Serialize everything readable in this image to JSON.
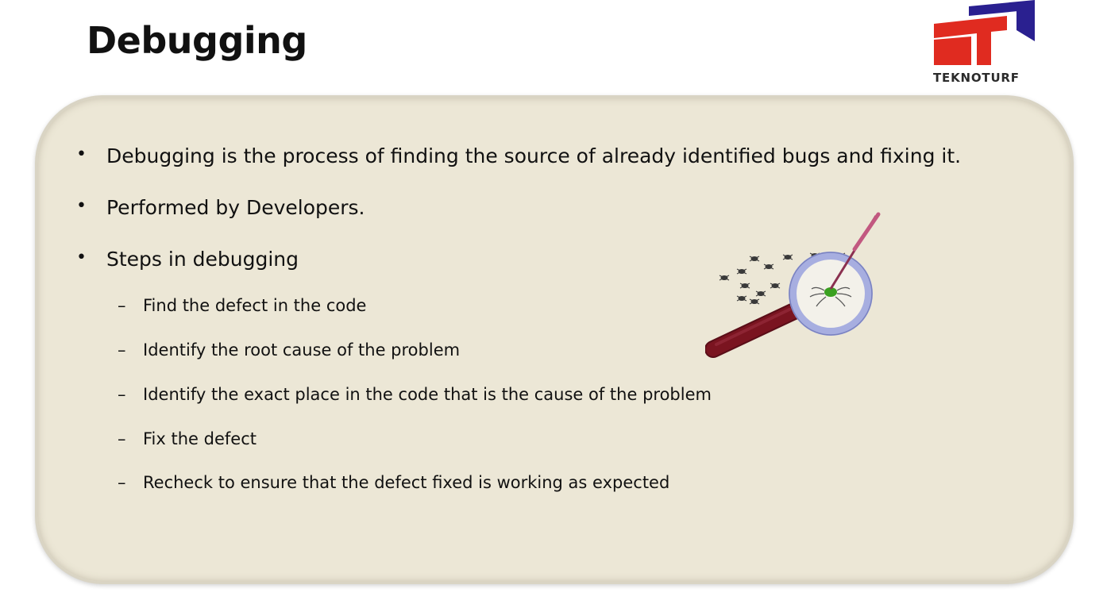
{
  "slide": {
    "title": "Debugging",
    "logo_text": "TEKNOTURF"
  },
  "bullets": [
    "Debugging is the process of finding the source of already identified bugs and fixing it.",
    "Performed by Developers.",
    "Steps in debugging"
  ],
  "steps": [
    "Find the defect in the code",
    "Identify the root cause of the problem",
    "Identify the exact place in the code that is the cause of the problem",
    "Fix the defect",
    "Recheck to ensure that the defect fixed is working as expected"
  ],
  "markers": {
    "bullet": "•",
    "dash": "–"
  },
  "colors": {
    "panel": "#ece7d6",
    "logo_red": "#e02b20",
    "logo_blue": "#2a2090",
    "handle": "#7a1420",
    "lens_ring": "#a7aee0"
  },
  "icons": [
    "teknoturf-logo",
    "magnifying-glass-bug-illustration"
  ]
}
